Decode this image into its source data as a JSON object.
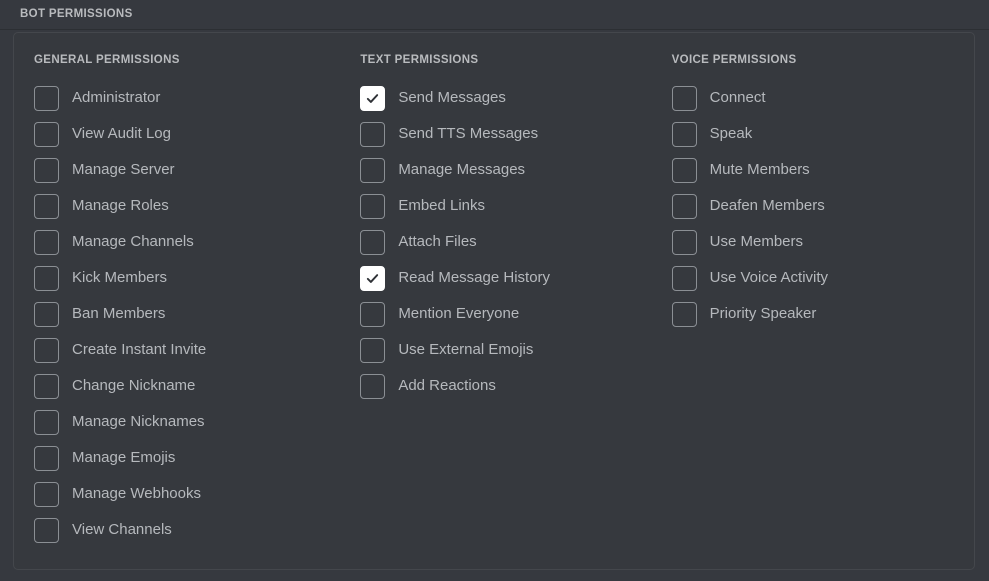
{
  "header": {
    "title": "BOT PERMISSIONS"
  },
  "colors": {
    "page_background": "#36393f",
    "panel_background": "#36393e",
    "panel_border": "#44474c",
    "header_text": "#b9bbbe",
    "label_text": "#b6b9bd",
    "checkbox_border": "#8b8f94",
    "checkbox_checked_fill": "#ffffff",
    "checkmark": "#2e3136"
  },
  "columns": [
    {
      "id": "general",
      "header": "GENERAL PERMISSIONS",
      "items": [
        {
          "label": "Administrator",
          "checked": false
        },
        {
          "label": "View Audit Log",
          "checked": false
        },
        {
          "label": "Manage Server",
          "checked": false
        },
        {
          "label": "Manage Roles",
          "checked": false
        },
        {
          "label": "Manage Channels",
          "checked": false
        },
        {
          "label": "Kick Members",
          "checked": false
        },
        {
          "label": "Ban Members",
          "checked": false
        },
        {
          "label": "Create Instant Invite",
          "checked": false
        },
        {
          "label": "Change Nickname",
          "checked": false
        },
        {
          "label": "Manage Nicknames",
          "checked": false
        },
        {
          "label": "Manage Emojis",
          "checked": false
        },
        {
          "label": "Manage Webhooks",
          "checked": false
        },
        {
          "label": "View Channels",
          "checked": false
        }
      ]
    },
    {
      "id": "text",
      "header": "TEXT PERMISSIONS",
      "items": [
        {
          "label": "Send Messages",
          "checked": true
        },
        {
          "label": "Send TTS Messages",
          "checked": false
        },
        {
          "label": "Manage Messages",
          "checked": false
        },
        {
          "label": "Embed Links",
          "checked": false
        },
        {
          "label": "Attach Files",
          "checked": false
        },
        {
          "label": "Read Message History",
          "checked": true
        },
        {
          "label": "Mention Everyone",
          "checked": false
        },
        {
          "label": "Use External Emojis",
          "checked": false
        },
        {
          "label": "Add Reactions",
          "checked": false
        }
      ]
    },
    {
      "id": "voice",
      "header": "VOICE PERMISSIONS",
      "items": [
        {
          "label": "Connect",
          "checked": false
        },
        {
          "label": "Speak",
          "checked": false
        },
        {
          "label": "Mute Members",
          "checked": false
        },
        {
          "label": "Deafen Members",
          "checked": false
        },
        {
          "label": "Use Members",
          "checked": false
        },
        {
          "label": "Use Voice Activity",
          "checked": false
        },
        {
          "label": "Priority Speaker",
          "checked": false
        }
      ]
    }
  ]
}
